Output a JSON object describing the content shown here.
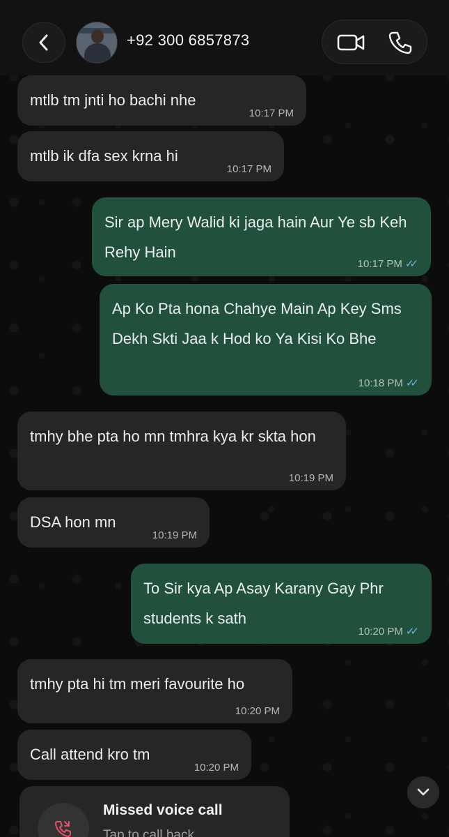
{
  "header": {
    "contact": "+92 300 6857873",
    "icons": {
      "back": "chevron-left-icon",
      "video": "video-call-icon",
      "phone": "phone-icon"
    }
  },
  "colors": {
    "incoming": "#262626",
    "outgoing": "#21503d",
    "read_tick": "#6db6e8",
    "missed": "#e0546b"
  },
  "messages": [
    {
      "dir": "in",
      "text": "mtlb tm jnti ho bachi nhe",
      "time": "10:17 PM"
    },
    {
      "dir": "in",
      "text": "mtlb ik dfa sex krna hi",
      "time": "10:17 PM"
    },
    {
      "dir": "out",
      "text": "Sir ap Mery Walid ki jaga hain Aur Ye sb Keh Rehy Hain",
      "time": "10:17 PM"
    },
    {
      "dir": "out",
      "text": "Ap Ko Pta hona Chahye Main Ap Key Sms Dekh Skti Jaa k Hod ko Ya Kisi Ko Bhe",
      "time": "10:18 PM"
    },
    {
      "dir": "in",
      "text": "tmhy bhe pta ho mn tmhra kya kr skta hon",
      "time": "10:19 PM"
    },
    {
      "dir": "in",
      "text": "DSA hon mn",
      "time": "10:19 PM"
    },
    {
      "dir": "out",
      "text": "To Sir kya Ap Asay Karany Gay Phr students k sath",
      "time": "10:20 PM"
    },
    {
      "dir": "in",
      "text": "tmhy pta hi tm meri favourite ho",
      "time": "10:20 PM"
    },
    {
      "dir": "in",
      "text": "Call attend kro tm",
      "time": "10:20 PM"
    }
  ],
  "missed_call": {
    "title": "Missed voice call",
    "subtitle": "Tap to call back",
    "icon": "missed-call-icon"
  },
  "scroll_button": {
    "icon": "chevron-down-icon"
  }
}
